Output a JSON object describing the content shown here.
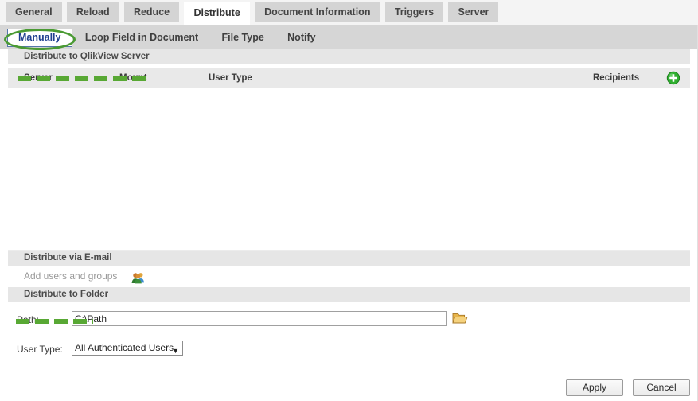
{
  "tabs": [
    {
      "label": "General",
      "active": false
    },
    {
      "label": "Reload",
      "active": false
    },
    {
      "label": "Reduce",
      "active": false
    },
    {
      "label": "Distribute",
      "active": true
    },
    {
      "label": "Document Information",
      "active": false
    },
    {
      "label": "Triggers",
      "active": false
    },
    {
      "label": "Server",
      "active": false
    }
  ],
  "subtabs": [
    {
      "label": "Manually",
      "active": true
    },
    {
      "label": "Loop Field in Document",
      "active": false
    },
    {
      "label": "File Type",
      "active": false
    },
    {
      "label": "Notify",
      "active": false
    }
  ],
  "qvs_section": {
    "title": "Distribute to QlikView Server",
    "columns": {
      "server": "Server",
      "mount": "Mount",
      "user_type": "User Type",
      "recipients": "Recipients"
    },
    "rows": [],
    "add_icon": "add-circle-icon"
  },
  "email_section": {
    "title": "Distribute via E-mail",
    "add_users_label": "Add users and groups",
    "users_icon": "users-group-icon"
  },
  "folder_section": {
    "title": "Distribute to Folder",
    "path_label": "Path:",
    "path_value": "C:\\Path",
    "path_placeholder": "",
    "browse_icon": "folder-open-icon",
    "user_type_label": "User Type:",
    "user_type_value": "All Authenticated Users",
    "user_type_caret": "▼"
  },
  "footer": {
    "apply_label": "Apply",
    "cancel_label": "Cancel"
  },
  "annotations": {
    "oval_color": "#4a9a33",
    "dash_color": "#58a834",
    "oval_target": "Manually",
    "dash_targets": [
      "Distribute to QlikView Server",
      "Distribute to Folder"
    ]
  },
  "colors": {
    "tab_inactive": "#d4d4d4",
    "tab_active": "#ffffff",
    "subtab_bar": "#d6d6d6",
    "section_header": "#e6e6e6",
    "grid_header": "#e9e9e9",
    "accent_green": "#58a834",
    "active_text": "#1f3f8f"
  }
}
